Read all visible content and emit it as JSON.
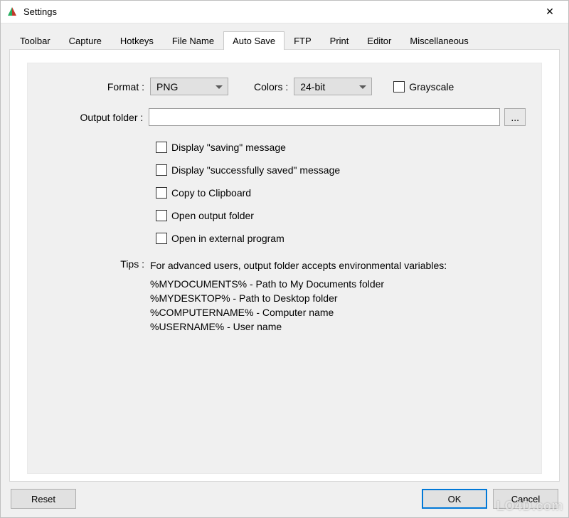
{
  "window": {
    "title": "Settings",
    "close_glyph": "✕"
  },
  "tabs": [
    {
      "label": "Toolbar"
    },
    {
      "label": "Capture"
    },
    {
      "label": "Hotkeys"
    },
    {
      "label": "File Name"
    },
    {
      "label": "Auto Save"
    },
    {
      "label": "FTP"
    },
    {
      "label": "Print"
    },
    {
      "label": "Editor"
    },
    {
      "label": "Miscellaneous"
    }
  ],
  "active_tab": "Auto Save",
  "autosave": {
    "format_label": "Format :",
    "format_value": "PNG",
    "colors_label": "Colors :",
    "colors_value": "24-bit",
    "grayscale_label": "Grayscale",
    "grayscale_checked": false,
    "output_folder_label": "Output folder :",
    "output_folder_value": "",
    "browse_label": "...",
    "checkboxes": [
      {
        "label": "Display \"saving\" message",
        "checked": false
      },
      {
        "label": "Display \"successfully saved\" message",
        "checked": false
      },
      {
        "label": "Copy to Clipboard",
        "checked": false
      },
      {
        "label": "Open output folder",
        "checked": false
      },
      {
        "label": "Open in external program",
        "checked": false
      }
    ],
    "tips_label": "Tips :",
    "tips_intro": "For advanced users, output folder accepts environmental variables:",
    "tips_lines": [
      "%MYDOCUMENTS% - Path to My Documents folder",
      "%MYDESKTOP% - Path to Desktop folder",
      "%COMPUTERNAME% - Computer name",
      "%USERNAME% - User name"
    ]
  },
  "footer": {
    "reset_label": "Reset",
    "ok_label": "OK",
    "cancel_label": "Cancel"
  },
  "watermark": "LO4D.com"
}
